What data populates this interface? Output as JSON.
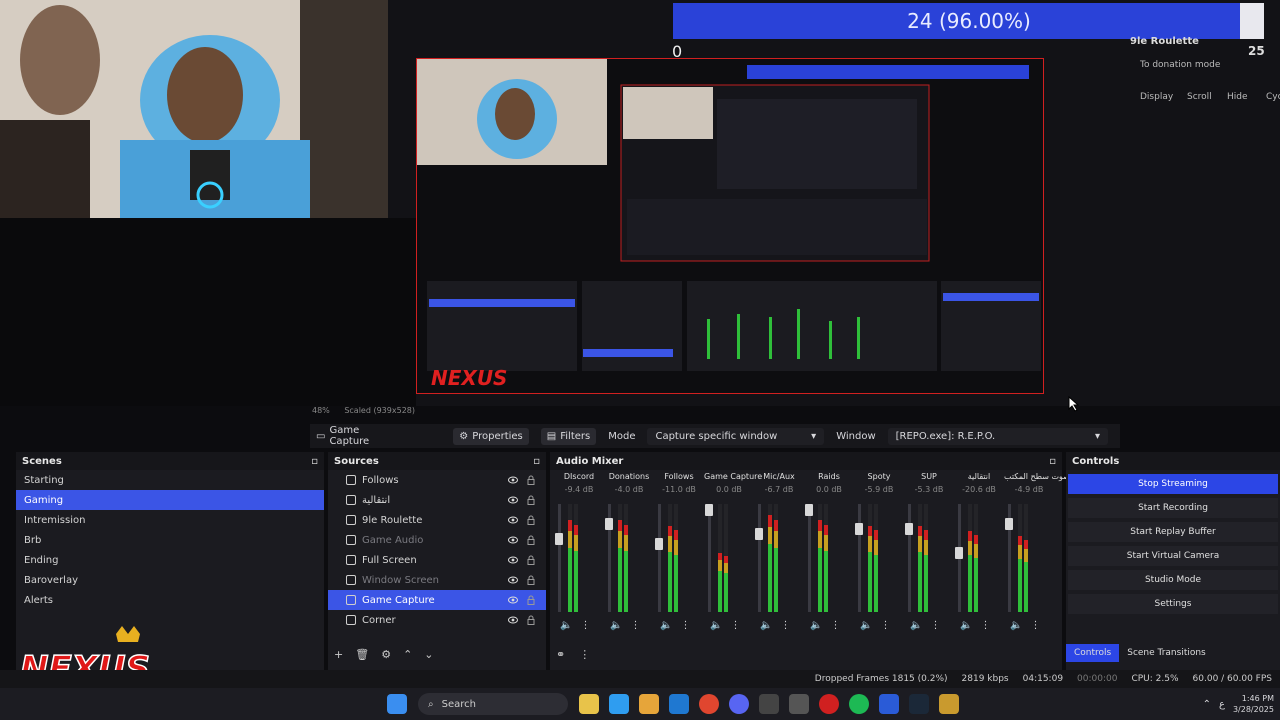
{
  "overlay": {
    "progress_text": "24 (96.00%)",
    "progress_value": 0.96,
    "zero_label": "0",
    "roulette_title": "9le Roulette",
    "roulette_count": "25",
    "donation_mode": "To donation mode",
    "buttons": [
      "Display",
      "Scroll",
      "Hide",
      "Cycle"
    ]
  },
  "preview": {
    "zoom": "48%",
    "scaled": "Scaled (939x528)"
  },
  "source_bar": {
    "source_name": "Game Capture",
    "properties_label": "Properties",
    "filters_label": "Filters",
    "mode_label": "Mode",
    "mode_value": "Capture specific window",
    "window_label": "Window",
    "window_value": "[REPO.exe]: R.E.P.O."
  },
  "scenes": {
    "title": "Scenes",
    "items": [
      "Starting",
      "Gaming",
      "Intremission",
      "Brb",
      "Ending",
      "Baroverlay",
      "Alerts"
    ],
    "active_index": 1
  },
  "sources": {
    "title": "Sources",
    "items": [
      {
        "label": "Follows",
        "dim": false
      },
      {
        "label": "انتقالية",
        "dim": false
      },
      {
        "label": "9le Roulette",
        "dim": false
      },
      {
        "label": "Game Audio",
        "dim": true
      },
      {
        "label": "Full Screen",
        "dim": false
      },
      {
        "label": "Window Screen",
        "dim": true
      },
      {
        "label": "Game Capture",
        "dim": false
      },
      {
        "label": "Corner",
        "dim": false
      }
    ],
    "active_index": 6
  },
  "mixer": {
    "title": "Audio Mixer",
    "channels": [
      {
        "name": "DIscord",
        "db": "-9.4 dB",
        "level": 0.85,
        "fader": 0.3
      },
      {
        "name": "Donations",
        "db": "-4.0 dB",
        "level": 0.85,
        "fader": 0.15
      },
      {
        "name": "Follows",
        "db": "-11.0 dB",
        "level": 0.8,
        "fader": 0.35
      },
      {
        "name": "Game Capture",
        "db": "0.0 dB",
        "level": 0.55,
        "fader": 0.0
      },
      {
        "name": "Mic/Aux",
        "db": "-6.7 dB",
        "level": 0.9,
        "fader": 0.25
      },
      {
        "name": "Raids",
        "db": "0.0 dB",
        "level": 0.85,
        "fader": 0.0
      },
      {
        "name": "Spoty",
        "db": "-5.9 dB",
        "level": 0.8,
        "fader": 0.2
      },
      {
        "name": "SUP",
        "db": "-5.3 dB",
        "level": 0.8,
        "fader": 0.2
      },
      {
        "name": "انتقالية",
        "db": "-20.6 dB",
        "level": 0.75,
        "fader": 0.45
      },
      {
        "name": "صوت سطح المكتب",
        "db": "-4.9 dB",
        "level": 0.7,
        "fader": 0.15
      }
    ]
  },
  "controls": {
    "title": "Controls",
    "buttons": [
      "Stop Streaming",
      "Start Recording",
      "Start Replay Buffer",
      "Start Virtual Camera",
      "Studio Mode",
      "Settings"
    ],
    "tabs": [
      "Controls",
      "Scene Transitions"
    ]
  },
  "status": {
    "dropped": "Dropped Frames 1815 (0.2%)",
    "kbps": "2819 kbps",
    "stream_time": "04:15:09",
    "rec_time": "00:00:00",
    "cpu": "CPU: 2.5%",
    "fps": "60.00 / 60.00 FPS"
  },
  "taskbar": {
    "search_label": "Search",
    "time": "1:46 PM",
    "date": "3/28/2025",
    "lang": "ع"
  },
  "colors": {
    "accent": "#3b55e6",
    "progress": "#2a42d8",
    "meter_green": "#2fbf3a",
    "meter_red": "#d02020"
  }
}
